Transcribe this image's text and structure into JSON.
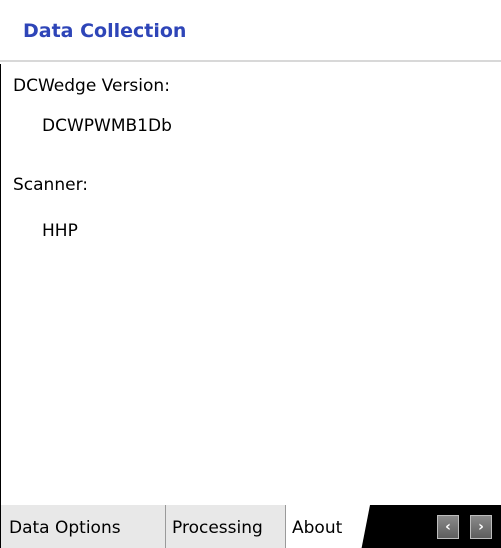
{
  "header": {
    "title": "Data Collection",
    "title_color": "#2e45b8"
  },
  "about": {
    "version_label": "DCWedge Version:",
    "version_value": "DCWPWMB1Db",
    "scanner_label": "Scanner:",
    "scanner_value": "HHP"
  },
  "tabs": [
    {
      "label": "Data Options",
      "active": false
    },
    {
      "label": "Processing",
      "active": false
    },
    {
      "label": "About",
      "active": true
    }
  ],
  "tab_scroll": {
    "left_icon": "chevron-left-icon",
    "right_icon": "chevron-right-icon",
    "left_glyph": "‹",
    "right_glyph": "›"
  }
}
